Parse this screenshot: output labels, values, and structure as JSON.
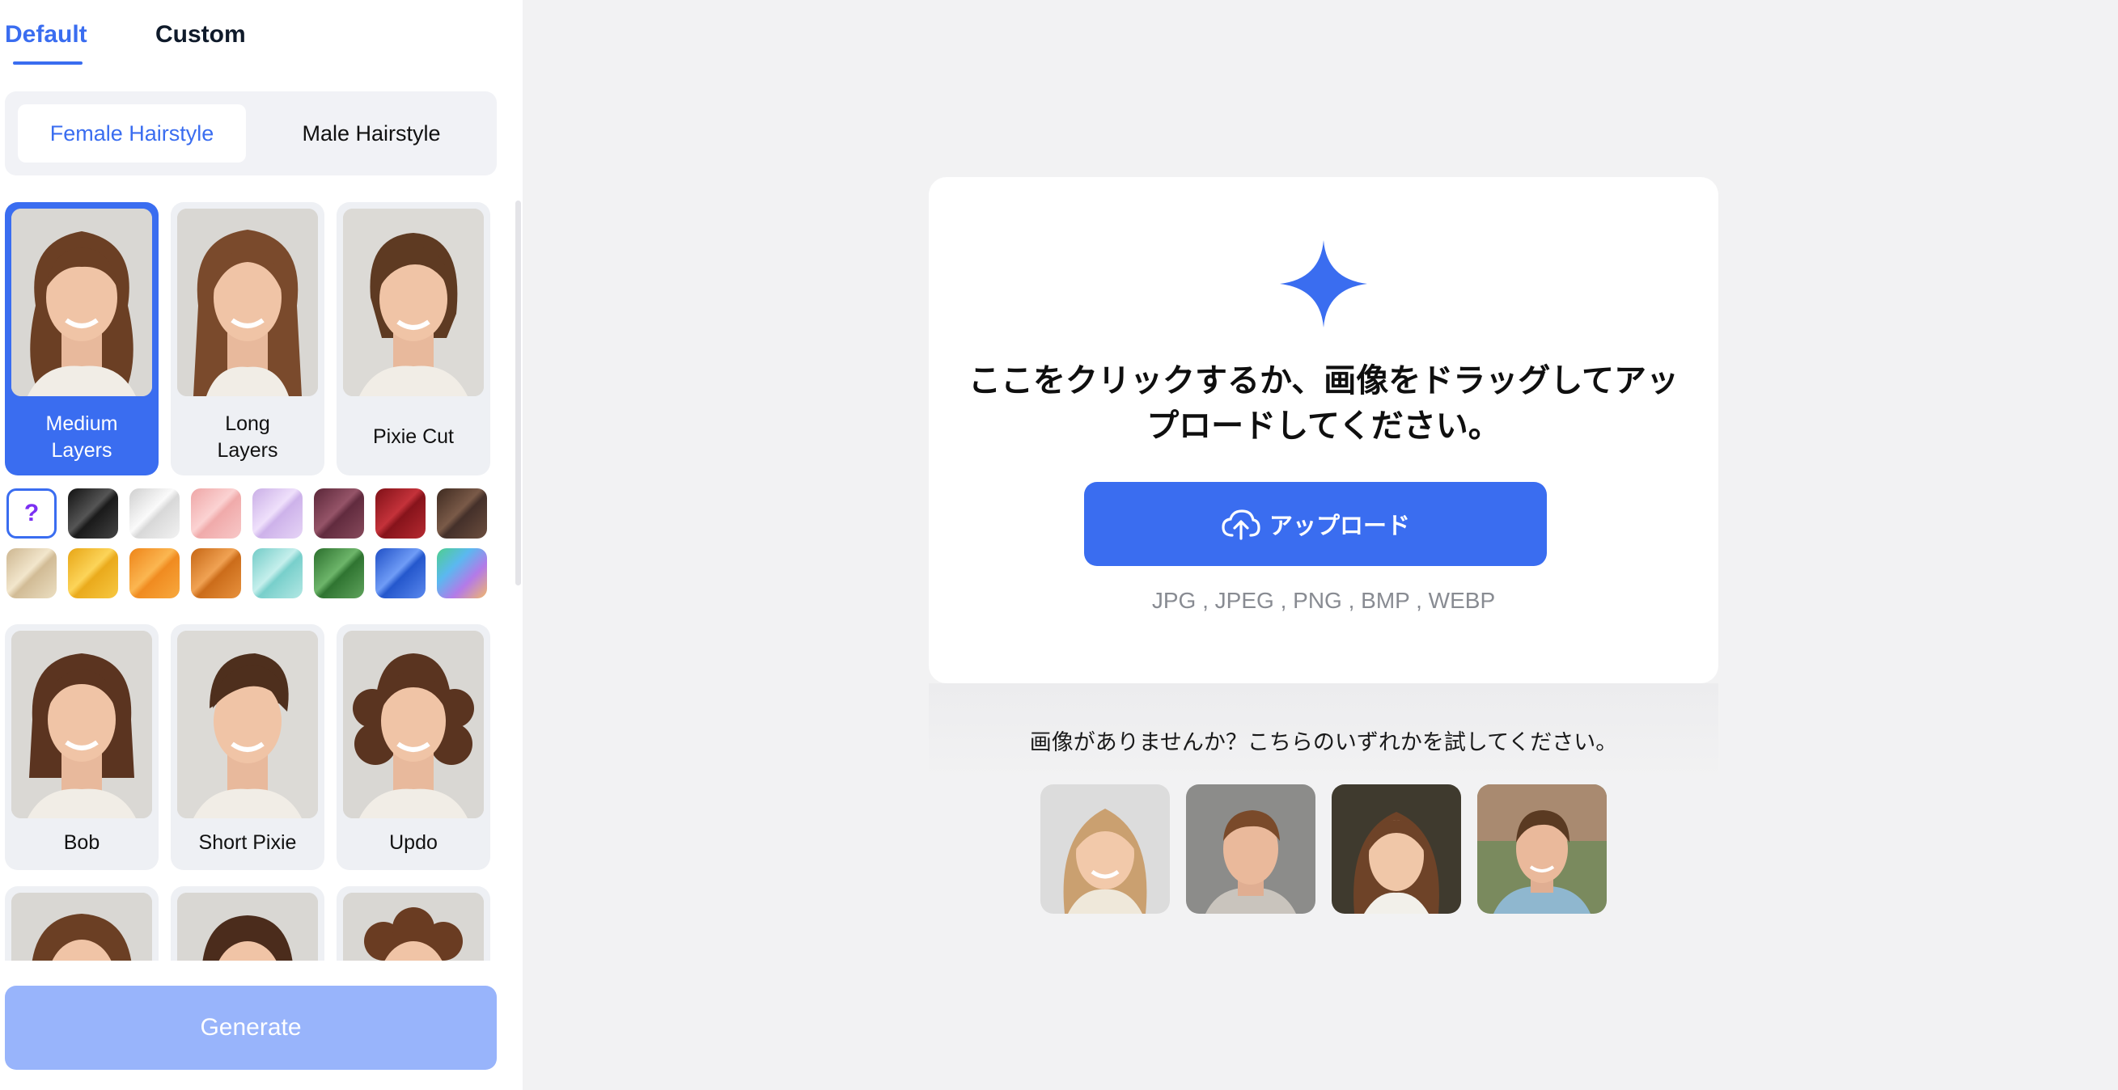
{
  "tabs": {
    "default": "Default",
    "custom": "Custom"
  },
  "gender_toggle": {
    "female": "Female Hairstyle",
    "male": "Male Hairstyle"
  },
  "hairstyles": [
    {
      "label": "Medium\nLayers",
      "selected": true
    },
    {
      "label": "Long\nLayers"
    },
    {
      "label": "Pixie Cut"
    },
    {
      "label": "Bob"
    },
    {
      "label": "Short Pixie"
    },
    {
      "label": "Updo"
    }
  ],
  "color_swatches": {
    "random_label": "?",
    "colors": [
      "#2b2b2b",
      "#e6e6e6",
      "#f2b4b4",
      "#dcc4ef",
      "#7a3a52",
      "#9e1b22",
      "#5c4234",
      "#d9c8a7",
      "#f0b92e",
      "#f39a2e",
      "#d9802a",
      "#8fd7d4",
      "#3f8a3f",
      "#2f6fe0",
      "#7ad3a0"
    ]
  },
  "generate_button": "Generate",
  "upload": {
    "title": "ここをクリックするか、画像をドラッグしてアップロードしてください。",
    "button": "アップロード",
    "formats": "JPG , JPEG , PNG , BMP , WEBP"
  },
  "samples": {
    "prompt": "画像がありませんか？こちらのいずれかを試してください。"
  },
  "colors": {
    "accent": "#3a6df0",
    "generate_disabled": "#98b4fb",
    "page_bg": "#f2f2f3"
  }
}
